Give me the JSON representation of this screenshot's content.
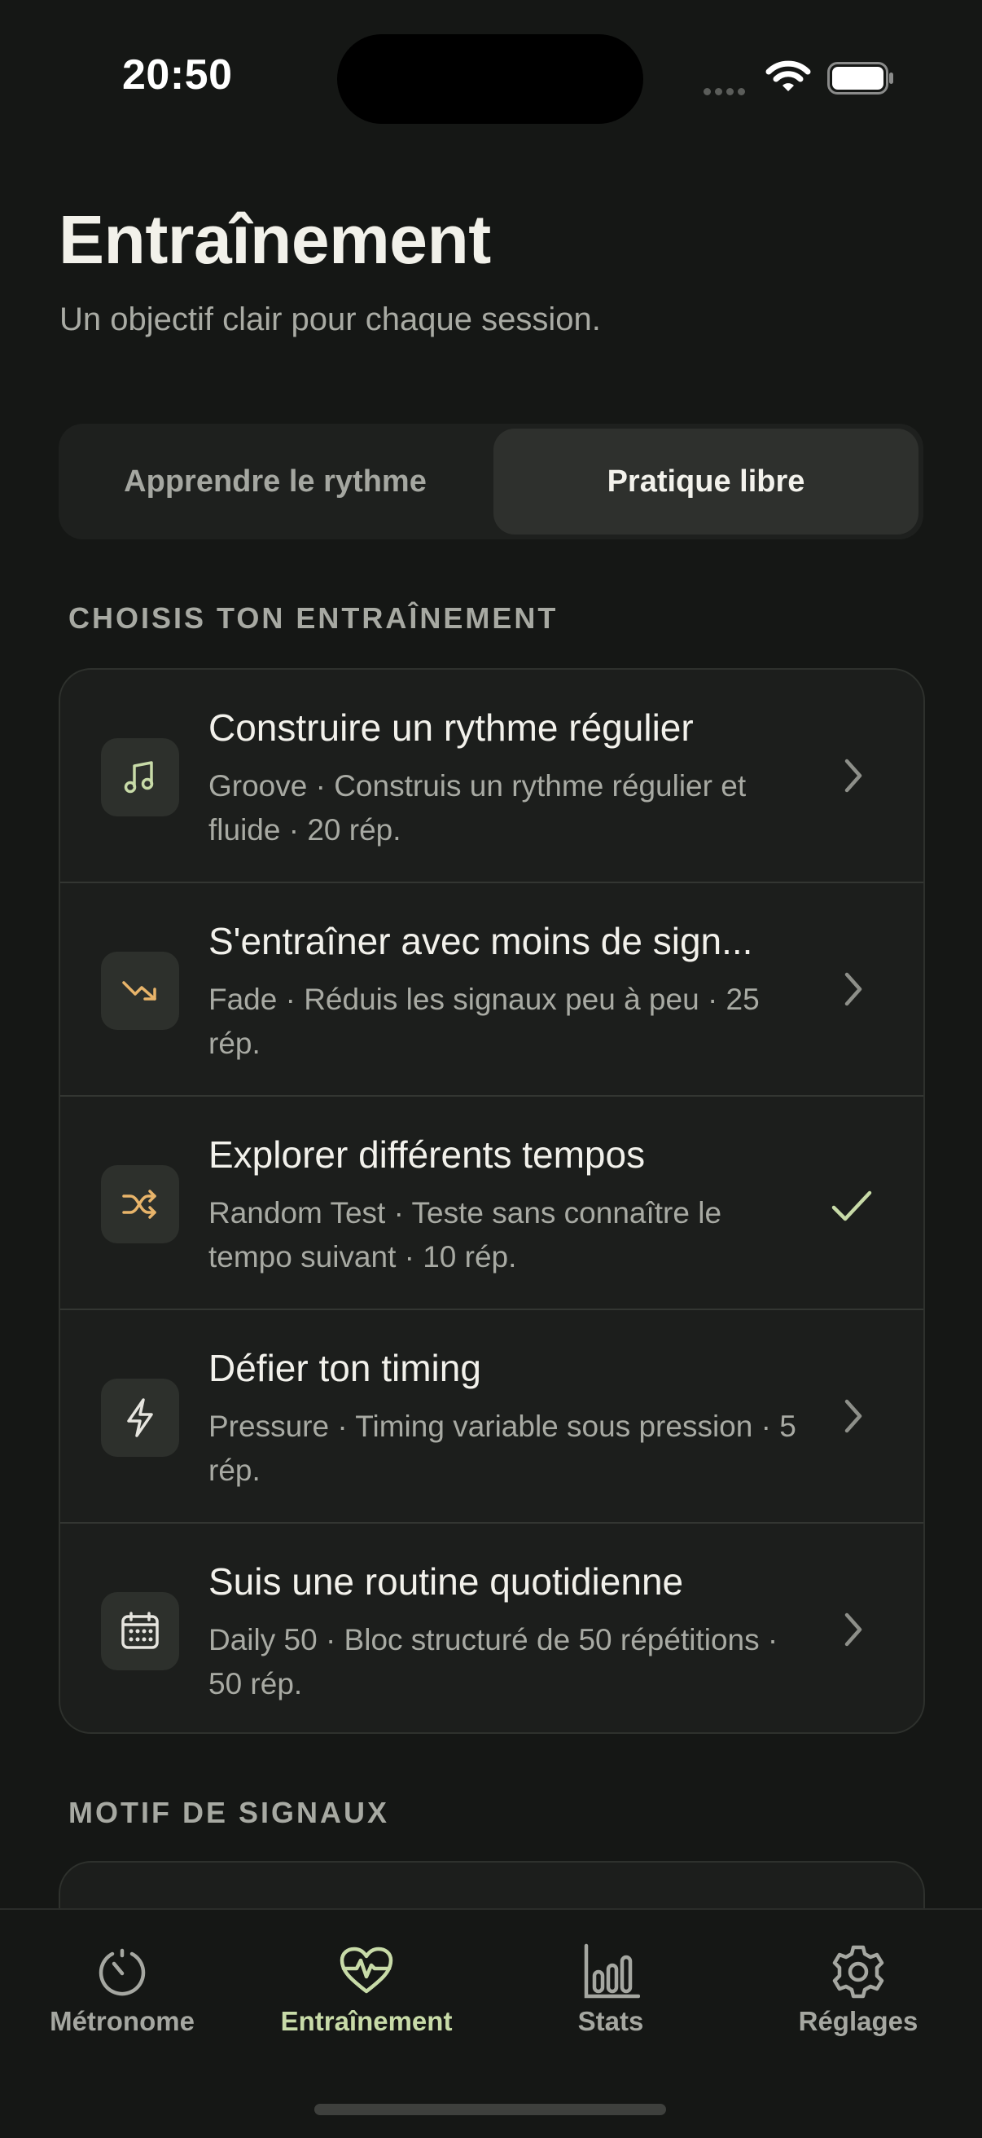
{
  "status": {
    "time": "20:50"
  },
  "header": {
    "title": "Entraînement",
    "subtitle": "Un objectif clair pour chaque session."
  },
  "segmented": {
    "options": [
      "Apprendre le rythme",
      "Pratique libre"
    ],
    "selected": "Pratique libre"
  },
  "sections": {
    "training_label": "CHOISIS TON ENTRAÎNEMENT",
    "cues_label": "MOTIF DE SIGNAUX"
  },
  "trainings": [
    {
      "title": "Construire un rythme régulier",
      "desc": "Groove · Construis un rythme régulier et fluide · 20 rép.",
      "icon": "music-note-icon",
      "state": "chevron"
    },
    {
      "title": "S'entraîner avec moins de sign...",
      "desc": "Fade · Réduis les signaux peu à peu · 25 rép.",
      "icon": "trend-down-icon",
      "state": "chevron"
    },
    {
      "title": "Explorer différents tempos",
      "desc": "Random Test · Teste sans connaître le tempo suivant · 10 rép.",
      "icon": "shuffle-icon",
      "state": "selected"
    },
    {
      "title": "Défier ton timing",
      "desc": "Pressure · Timing variable sous pression · 5 rép.",
      "icon": "lightning-icon",
      "state": "chevron"
    },
    {
      "title": "Suis une routine quotidienne",
      "desc": "Daily 50 · Bloc structuré de 50 répétitions · 50 rép.",
      "icon": "calendar-icon",
      "state": "chevron"
    }
  ],
  "tabbar": {
    "tabs": [
      {
        "label": "Métronome",
        "icon": "metronome-icon"
      },
      {
        "label": "Entraînement",
        "icon": "heart-pulse-icon"
      },
      {
        "label": "Stats",
        "icon": "bar-chart-icon"
      },
      {
        "label": "Réglages",
        "icon": "gear-icon"
      }
    ],
    "active": "Entraînement"
  },
  "colors": {
    "background": "#151715",
    "card": "#1C1E1C",
    "accent_green": "#C8DBA8",
    "accent_orange": "#E8B46A",
    "text_primary": "#F2F1EB",
    "text_secondary": "#A8AAA3"
  }
}
